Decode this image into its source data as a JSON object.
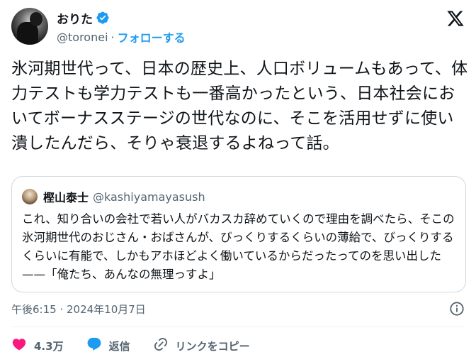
{
  "author": {
    "display_name": "おりた",
    "handle": "@toronei",
    "separator": "·",
    "follow_label": "フォローする",
    "verified_color": "#1d9bf0"
  },
  "tweet": {
    "text": "氷河期世代って、日本の歴史上、人口ボリュームもあって、体力テストも学力テストも一番高かったという、日本社会においてボーナスステージの世代なのに、そこを活用せずに使い潰したんだら、そりゃ衰退するよねって話。"
  },
  "quote": {
    "display_name": "樫山泰士",
    "handle": "@kashiyamayasush",
    "text": "これ、知り合いの会社で若い人がバカスカ辞めていくので理由を調べたら、そこの氷河期世代のおじさん・おばさんが、びっくりするくらいの薄給で、びっくりするくらいに有能で、しかもアホほどよく働いているからだったってのを思い出した——「俺たち、あんなの無理っすよ」"
  },
  "meta": {
    "timestamp": "午後6:15 · 2024年10月7日"
  },
  "actions": {
    "like_count": "4.3万",
    "reply_label": "返信",
    "copy_link_label": "リンクをコピー",
    "like_color": "#f91880",
    "reply_color": "#1d9bf0"
  },
  "icons": [
    "verified-badge-icon",
    "x-logo-icon",
    "info-icon",
    "heart-icon",
    "reply-bubble-icon",
    "link-icon"
  ]
}
